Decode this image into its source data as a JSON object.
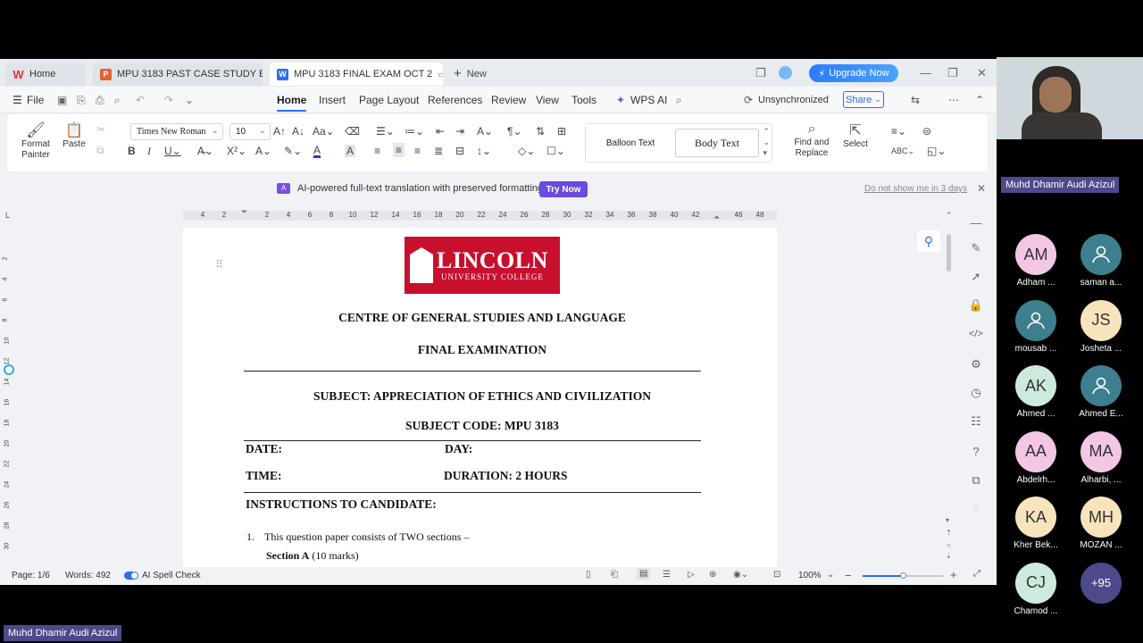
{
  "tabs": {
    "home": "Home",
    "tab1": "MPU 3183 PAST CASE STUDY EXAM (",
    "tab2": "MPU 3183 FINAL EXAM OCT 2",
    "new": "New"
  },
  "topbar": {
    "upgrade": "Upgrade Now"
  },
  "menu": {
    "file": "File",
    "items": [
      "Home",
      "Insert",
      "Page Layout",
      "References",
      "Review",
      "View",
      "Tools"
    ],
    "wps_ai": "WPS AI",
    "sync": "Unsynchronized",
    "share": "Share"
  },
  "ribbon": {
    "format_painter": "Format Painter",
    "paste": "Paste",
    "font": "Times New Roman",
    "size": "10",
    "styles": [
      "Balloon Text",
      "Body Text"
    ],
    "find_replace": "Find and Replace",
    "select": "Select"
  },
  "notification": {
    "message": "AI-powered full-text translation with preserved formatting.",
    "try_now": "Try Now",
    "dismiss": "Do not show me in 3 days"
  },
  "ruler": {
    "h_ticks": [
      "4",
      "2",
      "",
      "2",
      "4",
      "6",
      "8",
      "10",
      "12",
      "14",
      "16",
      "18",
      "20",
      "22",
      "24",
      "26",
      "28",
      "30",
      "32",
      "34",
      "36",
      "38",
      "40",
      "42",
      "",
      "46",
      "48"
    ],
    "v_ticks": [
      "2",
      "4",
      "6",
      "8",
      "10",
      "12",
      "14",
      "16",
      "18",
      "20",
      "22",
      "24",
      "26",
      "28",
      "30"
    ]
  },
  "document": {
    "logo_name": "LINCOLN",
    "logo_sub": "UNIVERSITY COLLEGE",
    "centre": "CENTRE OF GENERAL STUDIES AND LANGUAGE",
    "exam": "FINAL EXAMINATION",
    "subject": "SUBJECT: APPRECIATION OF ETHICS AND CIVILIZATION",
    "code": "SUBJECT CODE:  MPU 3183",
    "date": "DATE:",
    "day": "DAY:",
    "time": "TIME:",
    "duration": "DURATION: 2 HOURS",
    "instructions": "INSTRUCTIONS TO CANDIDATE:",
    "item1_num": "1.",
    "item1": "This question paper consists of TWO sections –",
    "section_a": "Section A",
    "section_a_marks": "(10 marks)"
  },
  "status": {
    "page": "Page: 1/6",
    "words": "Words: 492",
    "spell": "AI Spell Check",
    "zoom": "100%"
  },
  "meeting": {
    "presenter": "Muhd Dhamir Audi Azizul",
    "participants": [
      {
        "initials": "AM",
        "name": "Adham ...",
        "color": "#f3c6e6"
      },
      {
        "initials": "",
        "name": "saman a...",
        "color": "#3e7f8f"
      },
      {
        "initials": "",
        "name": "mousab ...",
        "color": "#3e7f8f"
      },
      {
        "initials": "JS",
        "name": "Josheta ...",
        "color": "#f7e4bd"
      },
      {
        "initials": "AK",
        "name": "Ahmed ...",
        "color": "#cdeadc"
      },
      {
        "initials": "",
        "name": "Ahmed E...",
        "color": "#3e7f8f"
      },
      {
        "initials": "AA",
        "name": "Abdelrh...",
        "color": "#f3c6e6"
      },
      {
        "initials": "MA",
        "name": "Alharbi, ...",
        "color": "#f3c6e6"
      },
      {
        "initials": "KA",
        "name": "Kher Bek...",
        "color": "#f7e4bd"
      },
      {
        "initials": "MH",
        "name": "MOZAN ...",
        "color": "#f7e4bd"
      },
      {
        "initials": "CJ",
        "name": "Chamod ...",
        "color": "#cdeadc"
      },
      {
        "initials": "+95",
        "name": "",
        "color": "#4d4a8c"
      }
    ]
  }
}
